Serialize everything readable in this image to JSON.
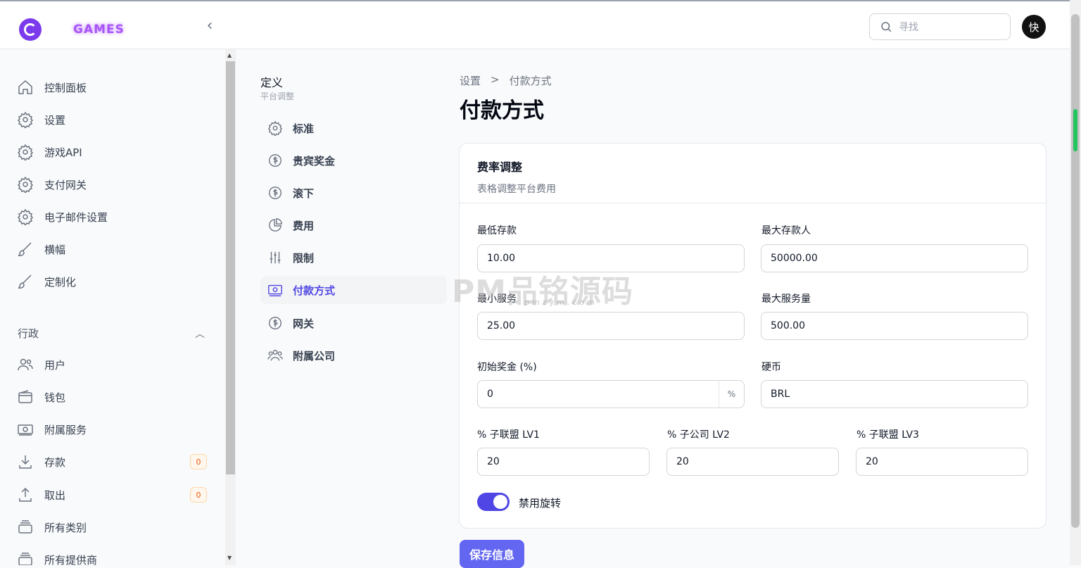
{
  "header": {
    "brand": "GAMES",
    "search_placeholder": "寻找",
    "avatar_text": "快"
  },
  "sidebar": {
    "items": [
      {
        "label": "控制面板",
        "icon": "home-icon"
      },
      {
        "label": "设置",
        "icon": "gear-icon"
      },
      {
        "label": "游戏API",
        "icon": "gear-icon"
      },
      {
        "label": "支付网关",
        "icon": "gear-icon"
      },
      {
        "label": "电子邮件设置",
        "icon": "gear-icon"
      },
      {
        "label": "横幅",
        "icon": "brush-icon"
      },
      {
        "label": "定制化",
        "icon": "brush-icon"
      }
    ],
    "group_label": "行政",
    "group_items": [
      {
        "label": "用户",
        "icon": "users-icon"
      },
      {
        "label": "钱包",
        "icon": "wallet-icon"
      },
      {
        "label": "附属服务",
        "icon": "money-icon"
      },
      {
        "label": "存款",
        "icon": "download-icon",
        "badge": "0"
      },
      {
        "label": "取出",
        "icon": "upload-icon",
        "badge": "0"
      },
      {
        "label": "所有类别",
        "icon": "stack-icon"
      },
      {
        "label": "所有提供商",
        "icon": "stack-icon"
      }
    ]
  },
  "subnav": {
    "title": "定义",
    "subtitle": "平台调整",
    "items": [
      {
        "label": "标准",
        "icon": "gear-icon"
      },
      {
        "label": "贵宾奖金",
        "icon": "dollar-icon"
      },
      {
        "label": "滚下",
        "icon": "dollar-icon"
      },
      {
        "label": "费用",
        "icon": "pie-chart-icon"
      },
      {
        "label": "限制",
        "icon": "sliders-icon"
      },
      {
        "label": "付款方式",
        "icon": "money-icon"
      },
      {
        "label": "网关",
        "icon": "dollar-icon"
      },
      {
        "label": "附属公司",
        "icon": "users-icon"
      }
    ]
  },
  "breadcrumb": {
    "parent": "设置",
    "sep": ">",
    "current": "付款方式"
  },
  "page_title": "付款方式",
  "card": {
    "title": "费率调整",
    "description": "表格调整平台费用",
    "fields": {
      "min_deposit": {
        "label": "最低存款",
        "value": "10.00"
      },
      "max_deposit": {
        "label": "最大存款人",
        "value": "50000.00"
      },
      "min_service": {
        "label": "最小服务",
        "value": "25.00"
      },
      "max_service": {
        "label": "最大服务量",
        "value": "500.00"
      },
      "initial_bonus": {
        "label": "初始奖金 (%)",
        "value": "0",
        "suffix": "%"
      },
      "currency": {
        "label": "硬币",
        "value": "BRL"
      },
      "lv1": {
        "label": "% 子联盟 LV1",
        "value": "20"
      },
      "lv2": {
        "label": "% 子公司 LV2",
        "value": "20"
      },
      "lv3": {
        "label": "% 子联盟 LV3",
        "value": "20"
      }
    },
    "toggle_label": "禁用旋转",
    "toggle_on": true
  },
  "save_label": "保存信息",
  "watermark": {
    "text": "PM品铭源码",
    "sub": "pmzym.com"
  }
}
